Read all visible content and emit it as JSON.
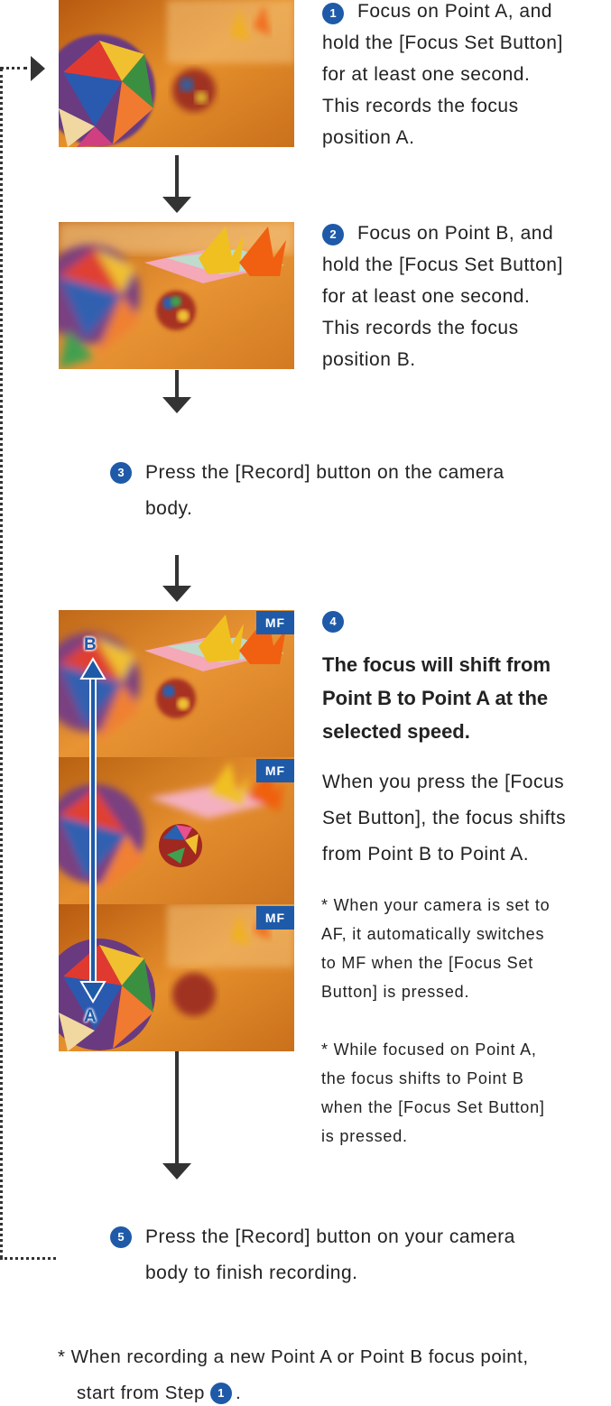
{
  "colors": {
    "accent": "#1e5aa8",
    "arrow": "#333333",
    "text": "#222222"
  },
  "step1": {
    "number": "1",
    "lines": [
      "Focus on Point A, and",
      "hold the [Focus Set Button]",
      "for at least one second.",
      "This records the focus",
      "position A."
    ]
  },
  "step2": {
    "number": "2",
    "lines": [
      "Focus on Point B, and",
      "hold the [Focus Set Button]",
      "for at least one second.",
      "This records the focus",
      "position B."
    ]
  },
  "step3": {
    "number": "3",
    "lines": [
      "Press the [Record] button on the camera",
      "body."
    ]
  },
  "step4": {
    "number": "4",
    "heading_lines": [
      "The focus will shift from",
      "Point B to Point A at the",
      "selected speed."
    ],
    "body_lines": [
      "When you press the [Focus",
      "Set Button], the focus shifts",
      "from Point B to Point A."
    ],
    "note1_lines": [
      "* When your camera is set to",
      "AF, it automatically switches",
      "to MF when the [Focus Set",
      "Button] is pressed."
    ],
    "note2_lines": [
      "* While focused on Point A,",
      "the focus shifts to Point B",
      "when the [Focus Set Button]",
      "is pressed."
    ],
    "mf_label": "MF",
    "point_b_label": "B",
    "point_a_label": "A"
  },
  "step5": {
    "number": "5",
    "lines": [
      "Press the [Record] button on your camera",
      "body to finish recording."
    ]
  },
  "footnote": {
    "line1": "* When recording a new Point A or Point B focus point,",
    "line2_prefix": "start from Step",
    "step_ref": "1",
    "line2_suffix": "."
  },
  "icons": [
    "right-triangle-icon",
    "down-arrow-icon",
    "step-number-icon",
    "double-arrow-icon"
  ]
}
